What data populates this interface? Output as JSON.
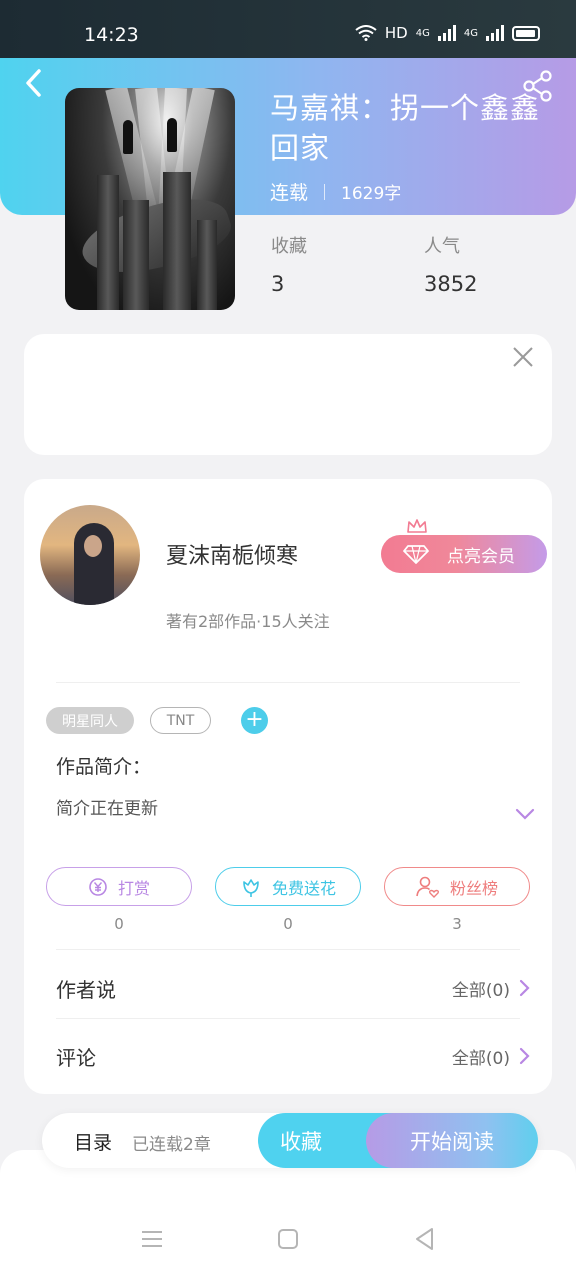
{
  "status_bar": {
    "time": "14:23",
    "network": "HD",
    "signal1": "4G",
    "signal2": "4G"
  },
  "book": {
    "title": "马嘉祺：拐一个鑫鑫回家",
    "status": "连载",
    "word_count": "1629字",
    "stats": [
      {
        "label": "收藏",
        "value": "3"
      },
      {
        "label": "人气",
        "value": "3852"
      }
    ]
  },
  "author": {
    "name": "夏沫南栀倾寒",
    "summary": "著有2部作品·15人关注",
    "vip_button": "点亮会员"
  },
  "tags": [
    "明星同人",
    "TNT"
  ],
  "intro": {
    "title": "作品简介：",
    "text": "简介正在更新"
  },
  "actions": [
    {
      "label": "打赏",
      "count": "0"
    },
    {
      "label": "免费送花",
      "count": "0"
    },
    {
      "label": "粉丝榜",
      "count": "3"
    }
  ],
  "sections": [
    {
      "label": "作者说",
      "more": "全部(0)"
    },
    {
      "label": "评论",
      "more": "全部(0)"
    }
  ],
  "bottom": {
    "toc": "目录",
    "toc_status": "已连载2章",
    "favorite": "收藏",
    "read": "开始阅读"
  },
  "colors": {
    "cyan": "#4fd2ef",
    "purple": "#b69be6",
    "pink": "#f27b92"
  }
}
